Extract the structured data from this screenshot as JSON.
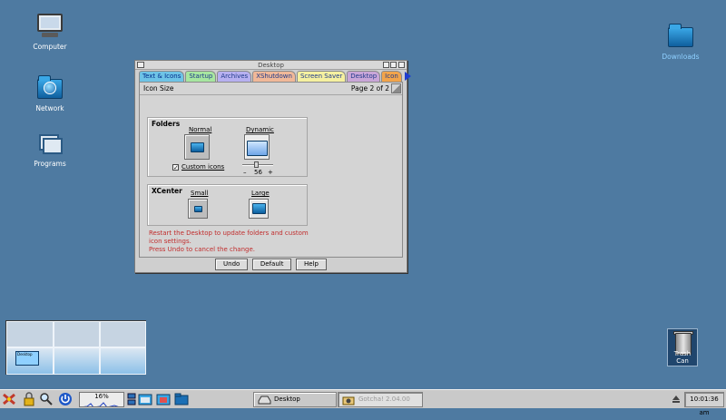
{
  "desktop": {
    "icons": [
      {
        "label": "Computer",
        "icon": "computer-icon"
      },
      {
        "label": "Network",
        "icon": "network-folder-icon"
      },
      {
        "label": "Programs",
        "icon": "programs-folder-icon"
      },
      {
        "label": "Downloads",
        "icon": "folder-icon"
      },
      {
        "label": "Trash Can",
        "icon": "trash-can-icon"
      }
    ]
  },
  "window": {
    "title": "Desktop",
    "tabs": [
      {
        "label": "Text & Icons",
        "color": "#6ec3e6",
        "active": true
      },
      {
        "label": "Startup",
        "color": "#a7e6a0"
      },
      {
        "label": "Archives",
        "color": "#b7b0f0"
      },
      {
        "label": "XShutdown",
        "color": "#f0b898"
      },
      {
        "label": "Screen Saver",
        "color": "#f5f0a0"
      },
      {
        "label": "Desktop",
        "color": "#c9a6d8"
      },
      {
        "label": "Icon",
        "color": "#f2a44a"
      }
    ],
    "page_title": "Icon Size",
    "page_indicator": "Page 2 of 2",
    "folders_group": {
      "title": "Folders",
      "normal_label": "Normal",
      "dynamic_label": "Dynamic",
      "custom_icons_label": "Custom icons",
      "custom_icons_checked": "✓",
      "slider_minus": "–",
      "slider_value": "56",
      "slider_plus": "+"
    },
    "xcenter_group": {
      "title": "XCenter",
      "small_label": "Small",
      "large_label": "Large"
    },
    "notice": [
      "Restart the Desktop to update folders and custom icon settings.",
      "Press Undo to cancel the change."
    ],
    "buttons": {
      "undo": "Undo",
      "default": "Default",
      "help": "Help"
    }
  },
  "pager": {
    "window_label": "Desktop"
  },
  "taskbar": {
    "cpu_label": "16%",
    "tasks": [
      {
        "label": "Desktop",
        "icon": "desktop-drive-icon"
      },
      {
        "label": "Gotcha! 2.04.00",
        "icon": "gotcha-camera-icon"
      }
    ],
    "clock": "10:01:36 am"
  }
}
